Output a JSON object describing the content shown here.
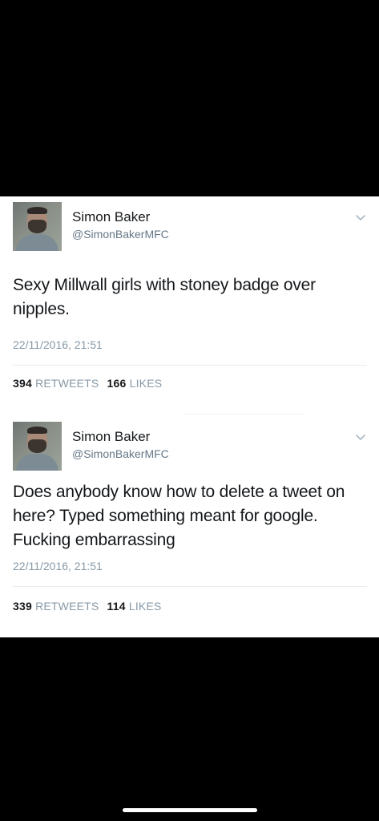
{
  "tweets": [
    {
      "name": "Simon Baker",
      "handle": "@SimonBakerMFC",
      "text": "Sexy Millwall girls with stoney badge over nipples.",
      "timestamp": "22/11/2016, 21:51",
      "retweets_count": "394",
      "retweets_label": "RETWEETS",
      "likes_count": "166",
      "likes_label": "LIKES"
    },
    {
      "name": "Simon Baker",
      "handle": "@SimonBakerMFC",
      "text": "Does anybody know how to delete a tweet on here? Typed something meant for google. Fucking embarrassing",
      "timestamp": "22/11/2016, 21:51",
      "retweets_count": "339",
      "retweets_label": "RETWEETS",
      "likes_count": "114",
      "likes_label": "LIKES"
    }
  ],
  "colors": {
    "background": "#000000",
    "card": "#ffffff",
    "text": "#14171a",
    "secondary": "#657786",
    "meta": "#8899a6"
  },
  "icons": {
    "menu": "chevron-down-icon",
    "avatar": "avatar",
    "home": "home-indicator"
  }
}
